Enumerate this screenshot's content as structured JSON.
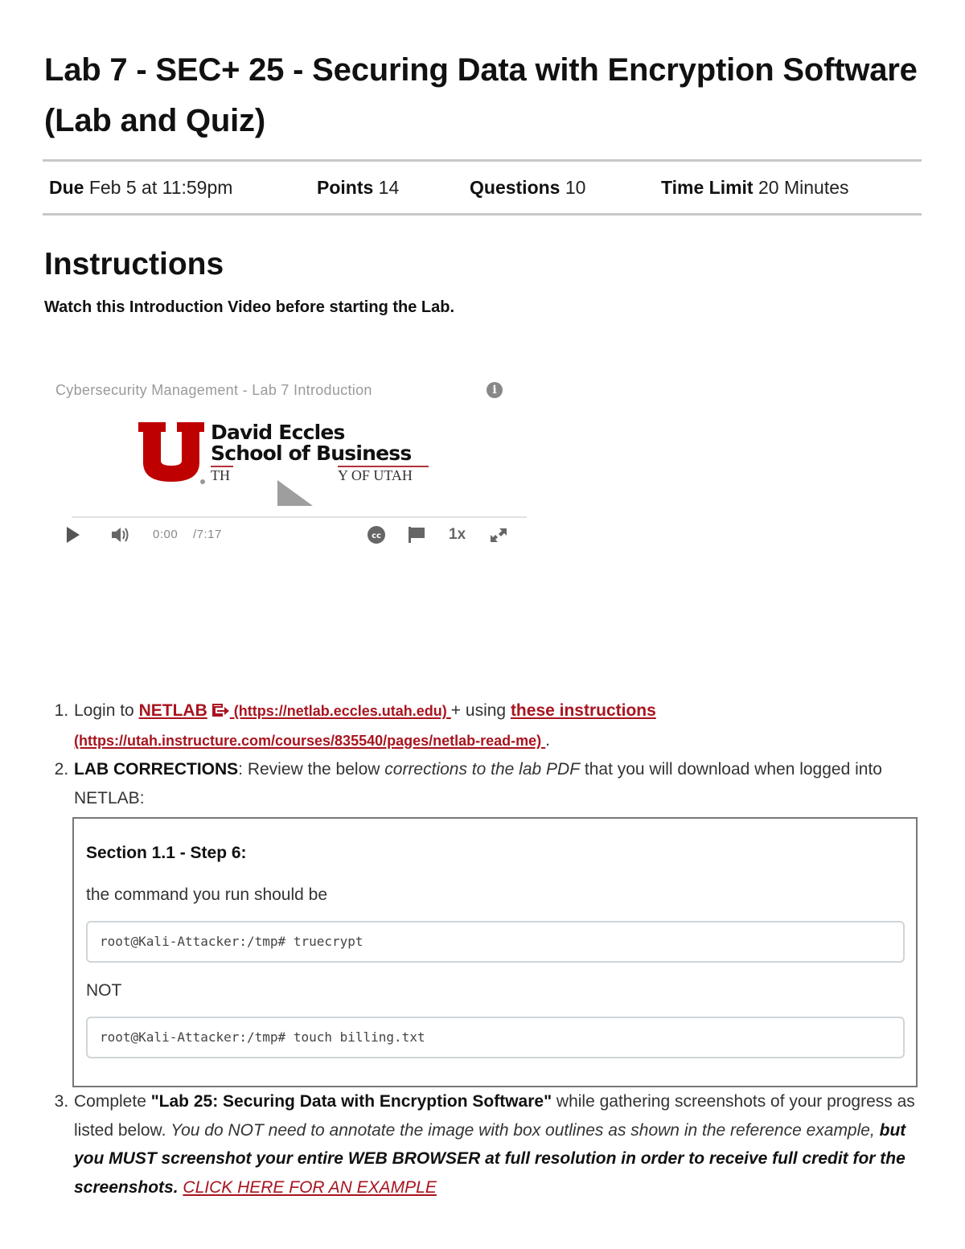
{
  "page": {
    "title": "Lab 7 - SEC+ 25 - Securing Data with Encryption Software (Lab and Quiz)"
  },
  "meta": {
    "due_label": "Due",
    "due_value": "Feb 5 at 11:59pm",
    "points_label": "Points",
    "points_value": "14",
    "questions_label": "Questions",
    "questions_value": "10",
    "time_limit_label": "Time Limit",
    "time_limit_value": "20 Minutes"
  },
  "instructions": {
    "heading": "Instructions",
    "watch_text": "Watch this Introduction Video before starting the Lab."
  },
  "video": {
    "title": "Cybersecurity Management - Lab 7 Introduction",
    "info_icon": "i",
    "logo_line1": "David Eccles",
    "logo_line2": "School of Business",
    "logo_sub_left": "TH",
    "logo_sub_right": "Y OF UTAH",
    "current_time": "0:00",
    "duration": "/7:17",
    "speed": "1x",
    "progress_fraction": 0,
    "icons": [
      "play-icon",
      "volume-icon",
      "closed-captions-icon",
      "flag-icon",
      "fullscreen-icon",
      "big-play-icon",
      "info-icon"
    ]
  },
  "steps": {
    "s1": {
      "prefix": "Login to ",
      "netlab_link": "NETLAB",
      "netlab_url_text": " (https://netlab.eccles.utah.edu) ",
      "mid": "+ using ",
      "instructions_link": "these instructions",
      "instructions_url_text": "(https://utah.instructure.com/courses/835540/pages/netlab-read-me) ",
      "suffix": "."
    },
    "s2": {
      "bold": "LAB CORRECTIONS",
      "t1": ": Review the below ",
      "italic": "corrections to the lab PDF",
      "t2": " that you will download when logged into NETLAB:",
      "box": {
        "section": "Section 1.1 - Step 6:",
        "intro": "the command you run should be",
        "correct_cmd": "root@Kali-Attacker:/tmp# truecrypt",
        "not_label": "NOT",
        "wrong_cmd": "root@Kali-Attacker:/tmp# touch billing.txt"
      }
    },
    "s3": {
      "prefix": "Complete ",
      "bold_quote": "\"Lab 25: Securing Data with Encryption Software\"",
      "t1": " while gathering screenshots of your progress as listed below. ",
      "italic": "You do NOT need to annotate the image with box outlines as shown in the reference example,",
      "bold_italic": " but you MUST screenshot your entire WEB BROWSER at full resolution in order to receive full credit for the screenshots.",
      "example_link": "CLICK HERE FOR AN EXAMPLE"
    }
  },
  "colors": {
    "link": "#a8141f",
    "utah_red": "#be0000",
    "rule": "#c8c8c8"
  }
}
